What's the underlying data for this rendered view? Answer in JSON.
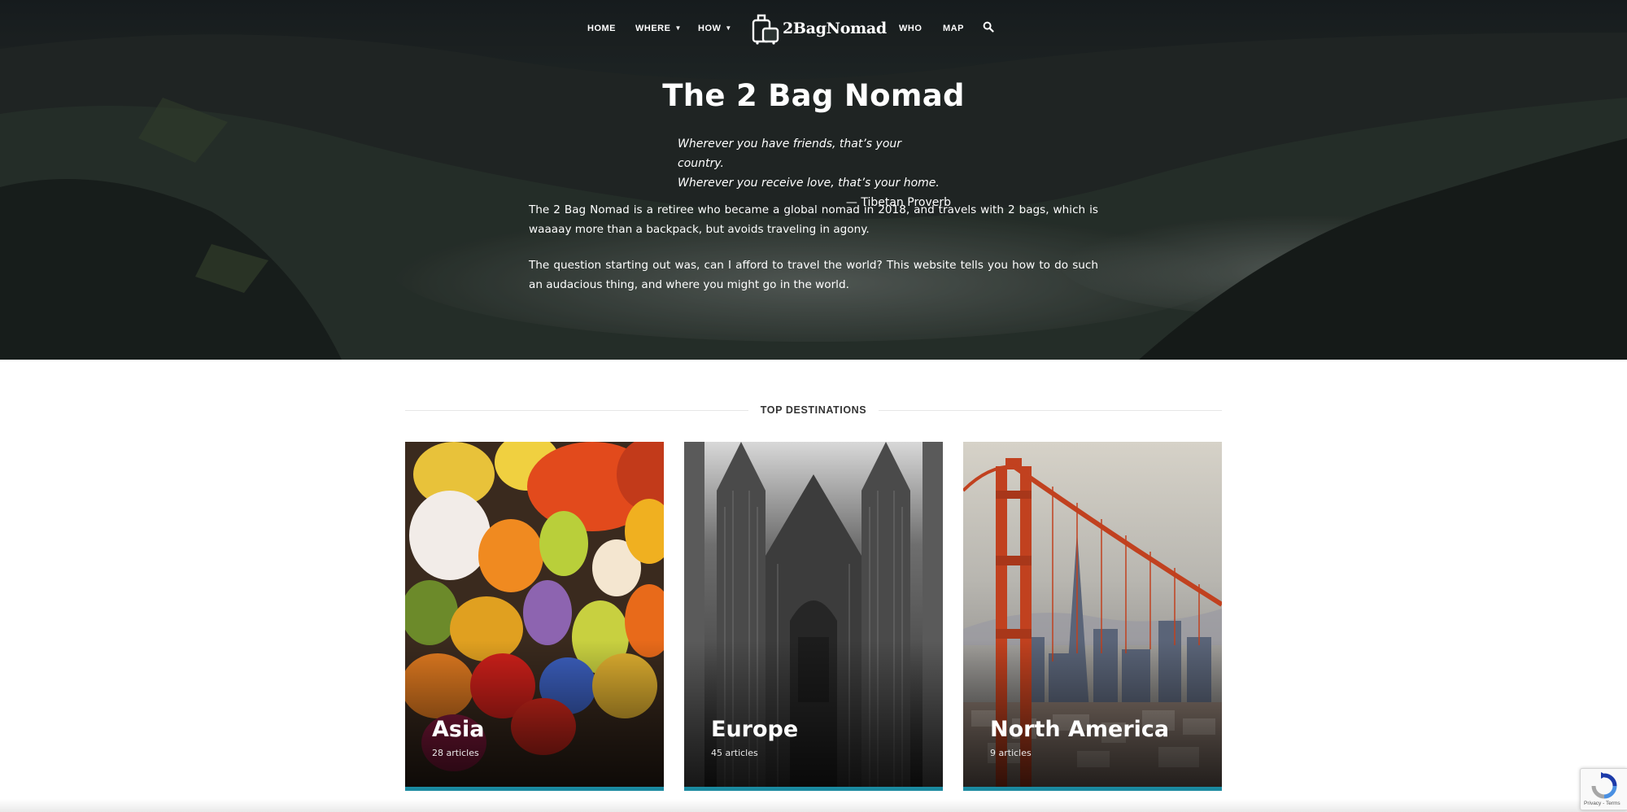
{
  "site": {
    "logo_text": "2BagNomad",
    "nav": {
      "home": "HOME",
      "where": "WHERE",
      "how": "HOW",
      "who": "WHO",
      "map": "MAP"
    },
    "icons": {
      "logo": "suitcase-icon",
      "dropdown": "chevron-down-icon",
      "search": "search-icon"
    }
  },
  "hero": {
    "title": "The 2 Bag Nomad",
    "quote_line1": "Wherever you have friends, that’s your country.",
    "quote_line2": "Wherever you receive love, that’s your home.",
    "quote_cite": "— Tibetan Proverb",
    "intro_p1": "The 2 Bag Nomad is a retiree who became a global nomad in 2018, and travels with 2 bags, which is waaaay more than a backpack, but avoids traveling in agony.",
    "intro_p2": "The question starting out was, can I afford to travel the world? This website tells you how to do such an audacious thing, and where you might go in the world."
  },
  "destinations": {
    "heading": "TOP DESTINATIONS",
    "cards": [
      {
        "name": "Asia",
        "count": "28 articles"
      },
      {
        "name": "Europe",
        "count": "45 articles"
      },
      {
        "name": "North America",
        "count": "9 articles"
      }
    ]
  },
  "recaptcha": {
    "terms": "Privacy - Terms"
  },
  "colors": {
    "accent": "#1b8aa0",
    "hero_overlay": "#2b3432",
    "text_on_dark": "#ffffff"
  }
}
